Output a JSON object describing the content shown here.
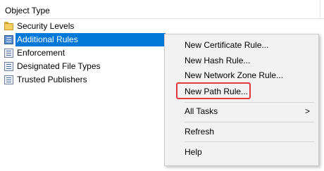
{
  "header": {
    "column_title": "Object Type"
  },
  "tree": {
    "items": [
      {
        "label": "Security Levels",
        "icon": "folder-icon"
      },
      {
        "label": "Additional Rules",
        "icon": "rules-document-icon",
        "selected": true
      },
      {
        "label": "Enforcement",
        "icon": "document-icon"
      },
      {
        "label": "Designated File Types",
        "icon": "document-icon"
      },
      {
        "label": "Trusted Publishers",
        "icon": "document-icon"
      }
    ]
  },
  "context_menu": {
    "items": [
      {
        "label": "New Certificate Rule..."
      },
      {
        "label": "New Hash Rule..."
      },
      {
        "label": "New Network Zone Rule..."
      },
      {
        "label": "New Path Rule...",
        "highlighted": true
      },
      {
        "label": "All Tasks",
        "submenu_arrow": ">"
      },
      {
        "label": "Refresh"
      },
      {
        "label": "Help"
      }
    ]
  },
  "colors": {
    "selection": "#0078d7",
    "highlight_box": "#e0393e",
    "menu_background": "#f2f2f2"
  }
}
